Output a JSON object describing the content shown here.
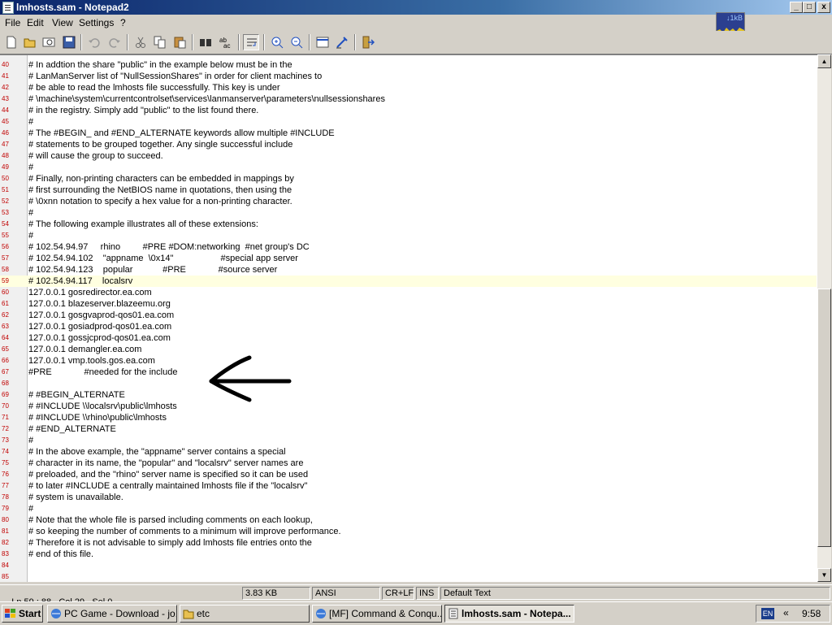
{
  "window": {
    "title": "lmhosts.sam - Notepad2",
    "buttons": {
      "minimize": "_",
      "maximize": "□",
      "close": "x"
    }
  },
  "menu": [
    "File",
    "Edit",
    "View",
    "Settings",
    "?"
  ],
  "netmeter": {
    "label": "↓1kB"
  },
  "toolbar": [
    "new-icon",
    "open-icon",
    "browse-icon",
    "save-icon",
    "undo-icon",
    "redo-icon",
    "cut-icon",
    "copy-icon",
    "paste-icon",
    "find-icon",
    "replace-icon",
    "word-wrap-icon",
    "zoom-in-icon",
    "zoom-out-icon",
    "scheme-icon",
    "customize-icon",
    "exit-icon"
  ],
  "editor": {
    "current_line": 59,
    "lines": [
      {
        "n": "40",
        "t": "# In addtion the share \"public\" in the example below must be in the"
      },
      {
        "n": "41",
        "t": "# LanManServer list of \"NullSessionShares\" in order for client machines to"
      },
      {
        "n": "42",
        "t": "# be able to read the lmhosts file successfully. This key is under"
      },
      {
        "n": "43",
        "t": "# \\machine\\system\\currentcontrolset\\services\\lanmanserver\\parameters\\nullsessionshares"
      },
      {
        "n": "44",
        "t": "# in the registry. Simply add \"public\" to the list found there."
      },
      {
        "n": "45",
        "t": "#"
      },
      {
        "n": "46",
        "t": "# The #BEGIN_ and #END_ALTERNATE keywords allow multiple #INCLUDE"
      },
      {
        "n": "47",
        "t": "# statements to be grouped together. Any single successful include"
      },
      {
        "n": "48",
        "t": "# will cause the group to succeed."
      },
      {
        "n": "49",
        "t": "#"
      },
      {
        "n": "50",
        "t": "# Finally, non-printing characters can be embedded in mappings by"
      },
      {
        "n": "51",
        "t": "# first surrounding the NetBIOS name in quotations, then using the"
      },
      {
        "n": "52",
        "t": "# \\0xnn notation to specify a hex value for a non-printing character."
      },
      {
        "n": "53",
        "t": "#"
      },
      {
        "n": "54",
        "t": "# The following example illustrates all of these extensions:"
      },
      {
        "n": "55",
        "t": "#"
      },
      {
        "n": "56",
        "t": "# 102.54.94.97     rhino         #PRE #DOM:networking  #net group's DC"
      },
      {
        "n": "57",
        "t": "# 102.54.94.102    \"appname  \\0x14\"                   #special app server"
      },
      {
        "n": "58",
        "t": "# 102.54.94.123    popular            #PRE             #source server"
      },
      {
        "n": "59",
        "t": "# 102.54.94.117    localsrv"
      },
      {
        "n": "60",
        "t": "127.0.0.1 gosredirector.ea.com"
      },
      {
        "n": "61",
        "t": "127.0.0.1 blazeserver.blazeemu.org"
      },
      {
        "n": "62",
        "t": "127.0.0.1 gosgvaprod-qos01.ea.com"
      },
      {
        "n": "63",
        "t": "127.0.0.1 gosiadprod-qos01.ea.com"
      },
      {
        "n": "64",
        "t": "127.0.0.1 gossjcprod-qos01.ea.com"
      },
      {
        "n": "65",
        "t": "127.0.0.1 demangler.ea.com"
      },
      {
        "n": "66",
        "t": "127.0.0.1 vmp.tools.gos.ea.com"
      },
      {
        "n": "67",
        "t": "#PRE             #needed for the include"
      },
      {
        "n": "68",
        "t": ""
      },
      {
        "n": "69",
        "t": "# #BEGIN_ALTERNATE"
      },
      {
        "n": "70",
        "t": "# #INCLUDE \\\\localsrv\\public\\lmhosts"
      },
      {
        "n": "71",
        "t": "# #INCLUDE \\\\rhino\\public\\lmhosts"
      },
      {
        "n": "72",
        "t": "# #END_ALTERNATE"
      },
      {
        "n": "73",
        "t": "#"
      },
      {
        "n": "74",
        "t": "# In the above example, the \"appname\" server contains a special"
      },
      {
        "n": "75",
        "t": "# character in its name, the \"popular\" and \"localsrv\" server names are"
      },
      {
        "n": "76",
        "t": "# preloaded, and the \"rhino\" server name is specified so it can be used"
      },
      {
        "n": "77",
        "t": "# to later #INCLUDE a centrally maintained lmhosts file if the \"localsrv\""
      },
      {
        "n": "78",
        "t": "# system is unavailable."
      },
      {
        "n": "79",
        "t": "#"
      },
      {
        "n": "80",
        "t": "# Note that the whole file is parsed including comments on each lookup,"
      },
      {
        "n": "81",
        "t": "# so keeping the number of comments to a minimum will improve performance."
      },
      {
        "n": "82",
        "t": "# Therefore it is not advisable to simply add lmhosts file entries onto the"
      },
      {
        "n": "83",
        "t": "# end of this file."
      },
      {
        "n": "84",
        "t": ""
      },
      {
        "n": "85",
        "t": ""
      }
    ]
  },
  "status": {
    "position": "Ln 59 : 88",
    "col": "Col 29",
    "sel": "Sel 0",
    "size": "3.83 KB",
    "encoding": "ANSI",
    "line_ending": "CR+LF",
    "mode": "INS",
    "scheme": "Default Text"
  },
  "taskbar": {
    "start": "Start",
    "tasks": [
      {
        "label": "PC Game - Download - jo...",
        "active": false
      },
      {
        "label": "etc",
        "active": false
      },
      {
        "label": "[MF] Command & Conqu...",
        "active": false
      },
      {
        "label": "lmhosts.sam - Notepa...",
        "active": true
      }
    ],
    "lang": "EN",
    "chevron": "«",
    "clock": "9:58"
  }
}
